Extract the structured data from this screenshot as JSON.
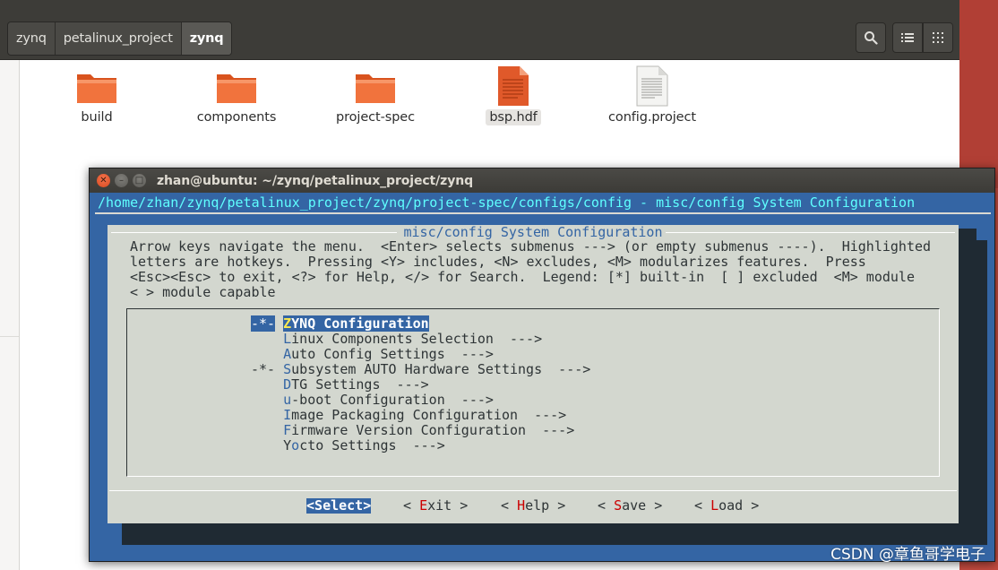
{
  "file_manager": {
    "breadcrumb": [
      "zynq",
      "petalinux_project",
      "zynq"
    ],
    "files": [
      {
        "name": "build",
        "icon": "folder-icon"
      },
      {
        "name": "components",
        "icon": "folder-icon"
      },
      {
        "name": "project-spec",
        "icon": "folder-icon"
      },
      {
        "name": "bsp.hdf",
        "icon": "document-orange-icon"
      },
      {
        "name": "config.project",
        "icon": "text-file-icon"
      }
    ],
    "toolbar_icons": [
      "search-icon",
      "list-view-icon",
      "grid-view-icon"
    ]
  },
  "terminal": {
    "title": "zhan@ubuntu: ~/zynq/petalinux_project/zynq",
    "path_line": "/home/zhan/zynq/petalinux_project/zynq/project-spec/configs/config - misc/config System Configuration",
    "dialog": {
      "title": " misc/config System Configuration ",
      "help": [
        "Arrow keys navigate the menu.  <Enter> selects submenus ---> (or empty submenus ----).  Highlighted",
        "letters are hotkeys.  Pressing <Y> includes, <N> excludes, <M> modularizes features.  Press",
        "<Esc><Esc> to exit, <?> for Help, </> for Search.  Legend: [*] built-in  [ ] excluded  <M> module",
        "< > module capable"
      ],
      "menu": [
        {
          "prefix": "-*-",
          "hotkey": "Z",
          "rest": "YNQ Configuration",
          "suffix": ""
        },
        {
          "prefix": "   ",
          "hotkey": "L",
          "rest": "inux Components Selection",
          "suffix": "  --->"
        },
        {
          "prefix": "   ",
          "hotkey": "A",
          "rest": "uto Config Settings",
          "suffix": "  --->"
        },
        {
          "prefix": "-*-",
          "hotkey": "S",
          "rest": "ubsystem AUTO Hardware Settings",
          "suffix": "  --->"
        },
        {
          "prefix": "   ",
          "hotkey": "D",
          "rest": "TG Settings",
          "suffix": "  --->"
        },
        {
          "prefix": "   ",
          "hotkey": "u",
          "rest": "-boot Configuration",
          "suffix": "  --->"
        },
        {
          "prefix": "   ",
          "hotkey": "I",
          "rest": "mage Packaging Configuration",
          "suffix": "  --->"
        },
        {
          "prefix": "   ",
          "hotkey": "F",
          "rest": "irmware Version Configuration",
          "suffix": "  --->"
        },
        {
          "prefix": "   ",
          "hotkey": "Y",
          "pre": "Y",
          "rest_after": "cto Settings",
          "hotkey_inner": "o",
          "suffix": "  --->"
        }
      ],
      "selected_index": 0,
      "buttons": [
        {
          "open": "<",
          "hotkey": "S",
          "rest": "elect",
          "close": ">"
        },
        {
          "open": "< ",
          "hotkey": "E",
          "rest": "xit",
          "close": " >"
        },
        {
          "open": "< ",
          "hotkey": "H",
          "rest": "elp",
          "close": " >"
        },
        {
          "open": "< ",
          "hotkey": "S",
          "rest": "ave",
          "close": " >"
        },
        {
          "open": "< ",
          "hotkey": "L",
          "rest": "oad",
          "close": " >"
        }
      ]
    }
  },
  "watermark": "CSDN @章鱼哥学电子",
  "colors": {
    "terminal_bg": "#3465a4",
    "dialog_bg": "#d3d7cf",
    "path_text": "#5fffff",
    "hotkey_menu": "#3465a4",
    "hotkey_button": "#cc0000",
    "folder_orange": "#e95420",
    "desktop": "#b13f35"
  }
}
